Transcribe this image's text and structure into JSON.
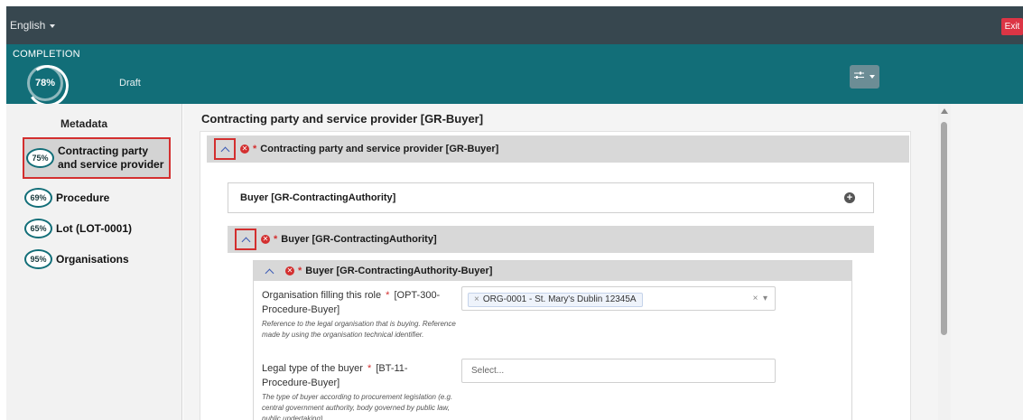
{
  "topbar": {
    "language": "English",
    "exit_label": "Exit"
  },
  "completion": {
    "label": "COMPLETION",
    "percent": "78%",
    "status": "Draft",
    "filter_icon": "sliders-icon"
  },
  "sidebar": {
    "heading": "Metadata",
    "items": [
      {
        "percent": "75%",
        "label": "Contracting party and service provider",
        "active": true
      },
      {
        "percent": "69%",
        "label": "Procedure"
      },
      {
        "percent": "65%",
        "label": "Lot (LOT-0001)"
      },
      {
        "percent": "95%",
        "label": "Organisations"
      }
    ]
  },
  "main": {
    "title": "Contracting party and service provider [GR-Buyer]",
    "section": {
      "label": "Contracting party and service provider  [GR-Buyer]"
    },
    "buyer_collapsed": {
      "label": "Buyer  [GR-ContractingAuthority]"
    },
    "buyer_section": {
      "label": "Buyer  [GR-ContractingAuthority]"
    },
    "buyer_inner": {
      "label": "Buyer  [GR-ContractingAuthority-Buyer]"
    },
    "fields": [
      {
        "label": "Organisation filling this role",
        "code": "[OPT-300-Procedure-Buyer]",
        "help": "Reference to the legal organisation that is buying. Reference made by using the organisation technical identifier.",
        "value": "ORG-0001 - St. Mary's Dublin 12345A"
      },
      {
        "label": "Legal type of the buyer",
        "code": "[BT-11-Procedure-Buyer]",
        "help": "The type of buyer according to procurement legislation (e.g. central government authority, body governed by public law, public undertaking)",
        "placeholder": "Select..."
      }
    ]
  },
  "colors": {
    "header": "#37474f",
    "teal": "#126e78",
    "error": "#d32f2f",
    "exit": "#dc3545"
  }
}
